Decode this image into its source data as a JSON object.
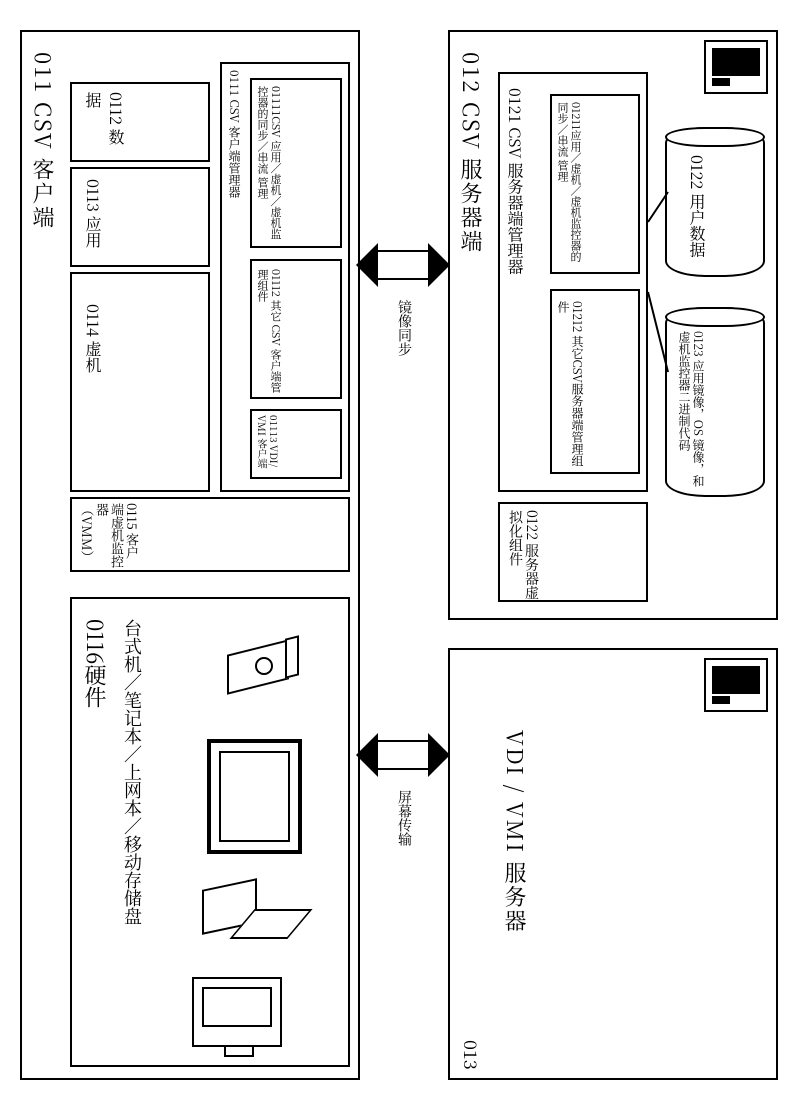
{
  "client": {
    "title": "011  CSV 客户端",
    "data": "0112 数据",
    "app": "0113 应用",
    "vm": "0114 虚机",
    "vmm": "0115 客户端虚机监控器（VMM）",
    "manager": {
      "title": "0111 CSV 客户端管理器",
      "sync": "01111CSV 应用／虚机／虚机监控器的同步／串流 管理",
      "other": "01112 其它 CSV 客户端管理组件",
      "vdi": "01113 VDI/ VMI 客户端"
    },
    "hardware": {
      "title": "0116硬件",
      "subtitle": "台式机／笔记本／上网本／移动存储盘"
    }
  },
  "server": {
    "title": "012  CSV 服务器端",
    "manager": {
      "title": "0121 CSV 服务器端管理器",
      "sync": "01211应用／虚机／虚机监控器的同步／串流 管理",
      "other": "01212 其它CSV服务器端管理组件"
    },
    "virt": "0122 服务器虚拟化组件",
    "userdata": "0122 用户数据",
    "images": "0123 应用镜像，OS 镜像，和虚机监控器二进制代码"
  },
  "vdivmi": "VDI / VMI 服务器",
  "vdivmi_id": "013",
  "arrow_top": "镜像同步",
  "arrow_bottom": "屏幕传输"
}
